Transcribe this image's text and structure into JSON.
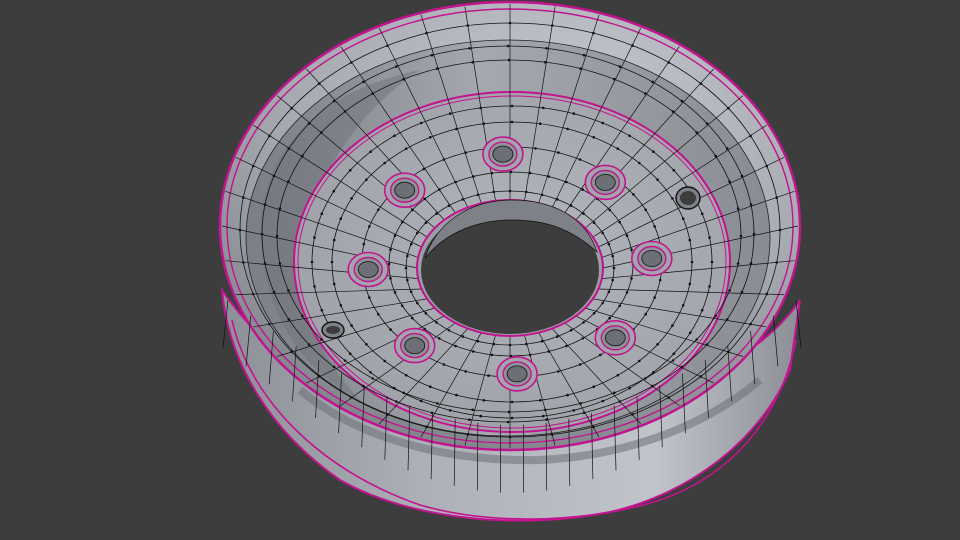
{
  "viewport": {
    "background": "#3d3d3d",
    "object": "wheel-rim-mesh",
    "mode": "edit-mode-wireframe-overlay"
  },
  "colors": {
    "surface_light": "#b9bbc4",
    "surface_mid": "#9a9ca4",
    "surface_dark": "#6d6f76",
    "wire": "#111111",
    "seam": "#c2148f",
    "hole": "#3d3d3d"
  },
  "mesh": {
    "bolt_holes": 8,
    "valve_holes": 2
  }
}
